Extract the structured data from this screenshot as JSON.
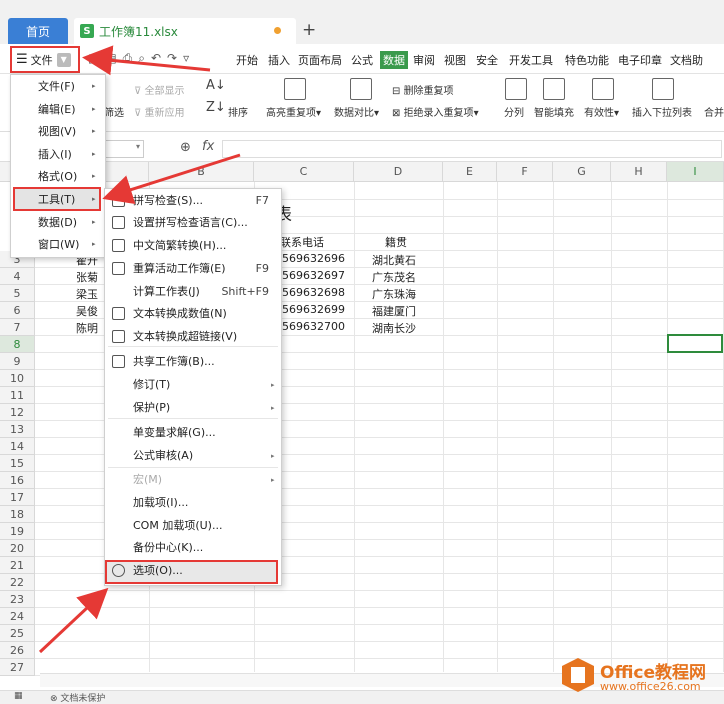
{
  "tabs": {
    "home": "首页",
    "doc": "工作簿11.xlsx",
    "new_tab": "+"
  },
  "menubar": {
    "file": "文件",
    "items": [
      "开始",
      "插入",
      "页面布局",
      "公式",
      "数据",
      "审阅",
      "视图",
      "安全",
      "开发工具",
      "特色功能",
      "电子印章",
      "文档助"
    ],
    "active": "数据"
  },
  "ribbon": {
    "filter": "筛选",
    "show_all": "全部显示",
    "reapply": "重新应用",
    "sort": "排序",
    "dup_highlight": "高亮重复项",
    "data_compare": "数据对比",
    "remove_dup": "删除重复项",
    "reject_dup": "拒绝录入重复项",
    "split": "分列",
    "smart_fill": "智能填充",
    "validity": "有效性",
    "insert_dropdown": "插入下拉列表",
    "merge": "合并"
  },
  "formula": {
    "fx": "fx",
    "zoom_icon": "magnifier-icon"
  },
  "columns": [
    "B",
    "C",
    "D",
    "E",
    "F",
    "G",
    "H",
    "I"
  ],
  "rows": [
    "3",
    "4",
    "5",
    "6",
    "7",
    "8",
    "9",
    "10",
    "11",
    "12",
    "13",
    "14",
    "15",
    "16",
    "17",
    "18",
    "19",
    "20",
    "21",
    "22",
    "23",
    "24",
    "25",
    "26",
    "27"
  ],
  "sheet": {
    "title": "讯表",
    "header_phone": "联系电话",
    "header_origin": "籍贯",
    "names": [
      "翟开",
      "张菊",
      "梁玉",
      "吴俊",
      "陈明"
    ],
    "phones": [
      "569632696",
      "569632697",
      "569632698",
      "569632699",
      "569632700"
    ],
    "origins": [
      "湖北黄石",
      "广东茂名",
      "广东珠海",
      "福建厦门",
      "湖南长沙"
    ]
  },
  "file_menu": {
    "items": [
      "文件(F)",
      "编辑(E)",
      "视图(V)",
      "插入(I)",
      "格式(O)",
      "工具(T)",
      "数据(D)",
      "窗口(W)"
    ]
  },
  "tools_menu": {
    "items": [
      {
        "label": "拼写检查(S)...",
        "shortcut": "F7"
      },
      {
        "label": "设置拼写检查语言(C)...",
        "shortcut": ""
      },
      {
        "label": "中文简繁转换(H)...",
        "shortcut": ""
      },
      {
        "label": "重算活动工作簿(E)",
        "shortcut": "F9"
      },
      {
        "label": "计算工作表(J)",
        "shortcut": "Shift+F9"
      },
      {
        "label": "文本转换成数值(N)",
        "shortcut": ""
      },
      {
        "label": "文本转换成超链接(V)",
        "shortcut": ""
      },
      {
        "label": "共享工作簿(B)...",
        "shortcut": ""
      },
      {
        "label": "修订(T)",
        "shortcut": ""
      },
      {
        "label": "保护(P)",
        "shortcut": ""
      },
      {
        "label": "单变量求解(G)...",
        "shortcut": ""
      },
      {
        "label": "公式审核(A)",
        "shortcut": ""
      },
      {
        "label": "宏(M)",
        "shortcut": ""
      },
      {
        "label": "加载项(I)...",
        "shortcut": ""
      },
      {
        "label": "COM 加载项(U)...",
        "shortcut": ""
      },
      {
        "label": "备份中心(K)...",
        "shortcut": ""
      },
      {
        "label": "选项(O)...",
        "shortcut": ""
      }
    ]
  },
  "status": {
    "protect": "文档未保护"
  },
  "watermark": {
    "brand": "Office教程网",
    "url": "www.office26.com"
  },
  "colors": {
    "accent_green": "#3a9a4c",
    "highlight_red": "#e53935",
    "tab_blue": "#3a7fd5"
  }
}
